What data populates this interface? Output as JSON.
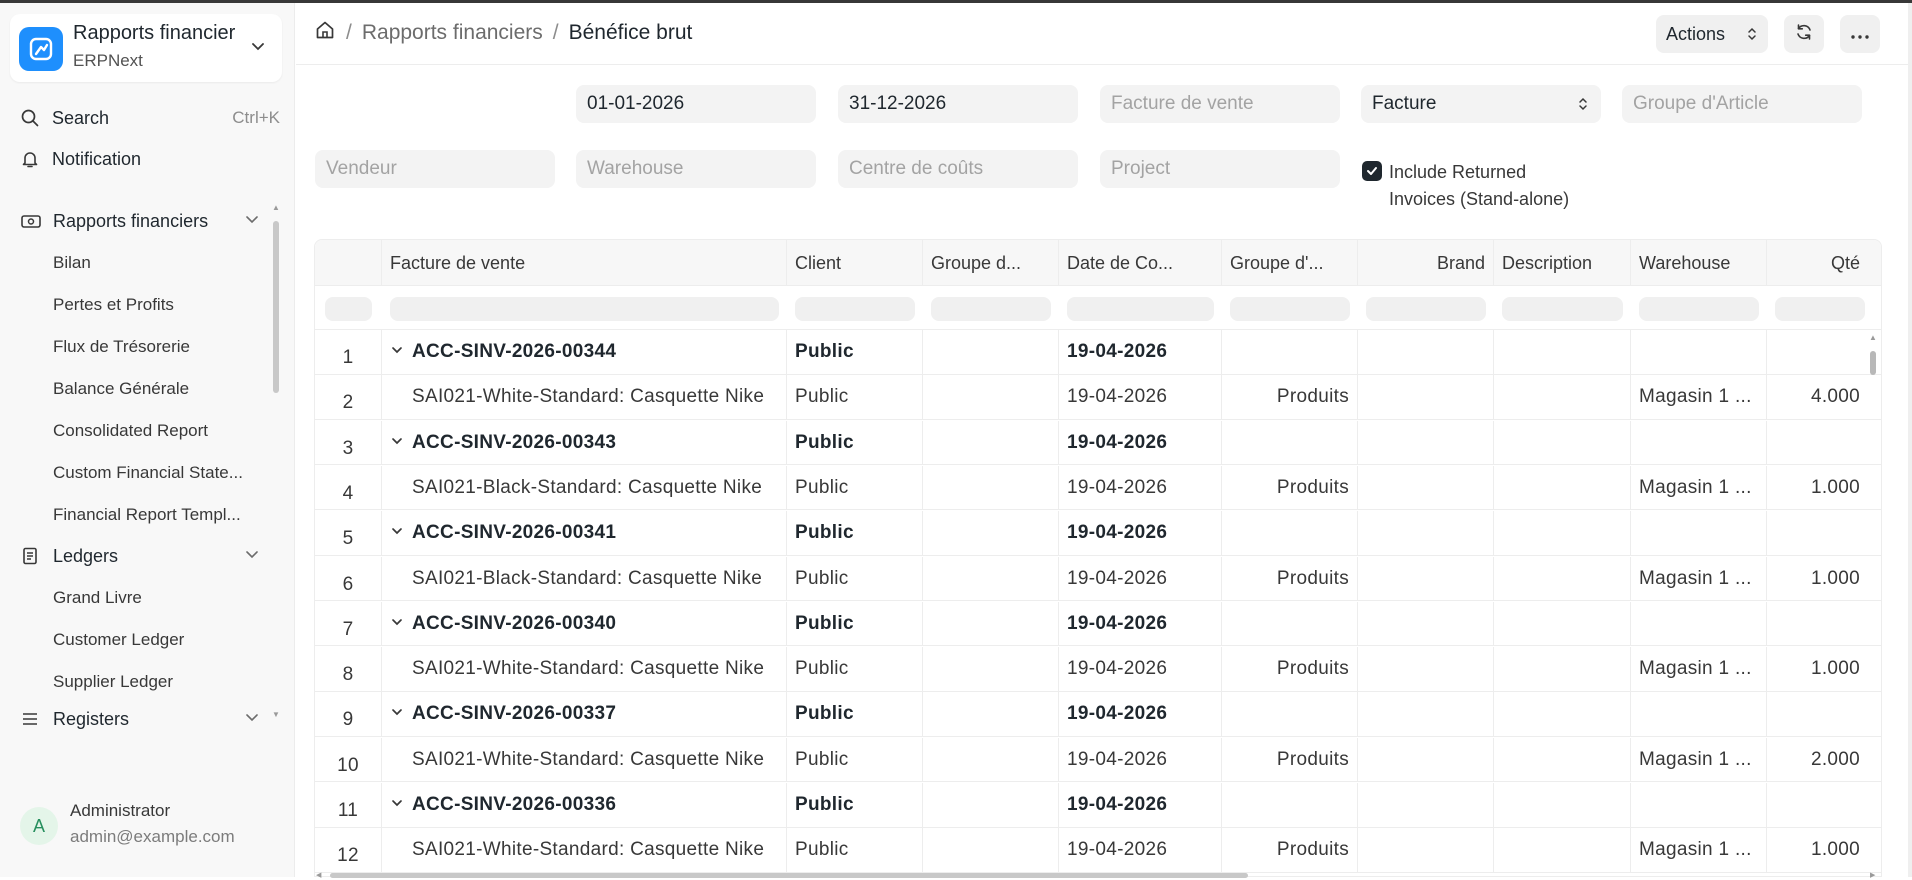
{
  "app": {
    "name": "Rapports financier",
    "subtitle": "ERPNext"
  },
  "sidebar": {
    "search_label": "Search",
    "search_shortcut": "Ctrl+K",
    "notification_label": "Notification",
    "section1": "Rapports financiers",
    "section1_items": [
      "Bilan",
      "Pertes et Profits",
      "Flux de Trésorerie",
      "Balance Générale",
      "Consolidated Report",
      "Custom Financial State...",
      "Financial Report Templ..."
    ],
    "section2": "Ledgers",
    "section2_items": [
      "Grand Livre",
      "Customer Ledger",
      "Supplier Ledger"
    ],
    "section3": "Registers"
  },
  "user": {
    "initial": "A",
    "name": "Administrator",
    "email": "admin@example.com"
  },
  "breadcrumb": {
    "parent": "Rapports financiers",
    "current": "Bénéfice brut",
    "sep": "/"
  },
  "toolbar": {
    "actions_label": "Actions"
  },
  "filters": {
    "from_date": "01-01-2026",
    "to_date": "31-12-2026",
    "sales_invoice_ph": "Facture de vente",
    "group_by": "Facture",
    "item_group_ph": "Groupe d'Article",
    "sales_person_ph": "Vendeur",
    "warehouse_ph": "Warehouse",
    "cost_center_ph": "Centre de coûts",
    "project_ph": "Project",
    "include_returned": "Include Returned Invoices (Stand-alone)",
    "include_returned_checked": true
  },
  "table": {
    "columns": [
      "Facture de vente",
      "Client",
      "Groupe d...",
      "Date de Co...",
      "Groupe d'...",
      "Brand",
      "Description",
      "Warehouse",
      "Qté"
    ],
    "rows": [
      {
        "n": "1",
        "group": true,
        "invoice": "ACC-SINV-2026-00344",
        "client": "Public",
        "cgroup": "",
        "date": "19-04-2026",
        "igroup": "",
        "brand": "",
        "desc": "",
        "wh": "",
        "qty": ""
      },
      {
        "n": "2",
        "group": false,
        "invoice": "SAI021-White-Standard: Casquette Nike",
        "client": "Public",
        "cgroup": "",
        "date": "19-04-2026",
        "igroup": "Produits",
        "brand": "",
        "desc": "",
        "wh": "Magasin 1 ...",
        "qty": "4.000"
      },
      {
        "n": "3",
        "group": true,
        "invoice": "ACC-SINV-2026-00343",
        "client": "Public",
        "cgroup": "",
        "date": "19-04-2026",
        "igroup": "",
        "brand": "",
        "desc": "",
        "wh": "",
        "qty": ""
      },
      {
        "n": "4",
        "group": false,
        "invoice": "SAI021-Black-Standard: Casquette Nike",
        "client": "Public",
        "cgroup": "",
        "date": "19-04-2026",
        "igroup": "Produits",
        "brand": "",
        "desc": "",
        "wh": "Magasin 1 ...",
        "qty": "1.000"
      },
      {
        "n": "5",
        "group": true,
        "invoice": "ACC-SINV-2026-00341",
        "client": "Public",
        "cgroup": "",
        "date": "19-04-2026",
        "igroup": "",
        "brand": "",
        "desc": "",
        "wh": "",
        "qty": ""
      },
      {
        "n": "6",
        "group": false,
        "invoice": "SAI021-Black-Standard: Casquette Nike",
        "client": "Public",
        "cgroup": "",
        "date": "19-04-2026",
        "igroup": "Produits",
        "brand": "",
        "desc": "",
        "wh": "Magasin 1 ...",
        "qty": "1.000"
      },
      {
        "n": "7",
        "group": true,
        "invoice": "ACC-SINV-2026-00340",
        "client": "Public",
        "cgroup": "",
        "date": "19-04-2026",
        "igroup": "",
        "brand": "",
        "desc": "",
        "wh": "",
        "qty": ""
      },
      {
        "n": "8",
        "group": false,
        "invoice": "SAI021-White-Standard: Casquette Nike",
        "client": "Public",
        "cgroup": "",
        "date": "19-04-2026",
        "igroup": "Produits",
        "brand": "",
        "desc": "",
        "wh": "Magasin 1 ...",
        "qty": "1.000"
      },
      {
        "n": "9",
        "group": true,
        "invoice": "ACC-SINV-2026-00337",
        "client": "Public",
        "cgroup": "",
        "date": "19-04-2026",
        "igroup": "",
        "brand": "",
        "desc": "",
        "wh": "",
        "qty": ""
      },
      {
        "n": "10",
        "group": false,
        "invoice": "SAI021-White-Standard: Casquette Nike",
        "client": "Public",
        "cgroup": "",
        "date": "19-04-2026",
        "igroup": "Produits",
        "brand": "",
        "desc": "",
        "wh": "Magasin 1 ...",
        "qty": "2.000"
      },
      {
        "n": "11",
        "group": true,
        "invoice": "ACC-SINV-2026-00336",
        "client": "Public",
        "cgroup": "",
        "date": "19-04-2026",
        "igroup": "",
        "brand": "",
        "desc": "",
        "wh": "",
        "qty": ""
      },
      {
        "n": "12",
        "group": false,
        "invoice": "SAI021-White-Standard: Casquette Nike",
        "client": "Public",
        "cgroup": "",
        "date": "19-04-2026",
        "igroup": "Produits",
        "brand": "",
        "desc": "",
        "wh": "Magasin 1 ...",
        "qty": "1.000"
      }
    ]
  },
  "icons": {
    "home": "home-icon",
    "refresh": "refresh-icon",
    "more": "more-icon",
    "search": "search-icon",
    "bell": "bell-icon"
  }
}
